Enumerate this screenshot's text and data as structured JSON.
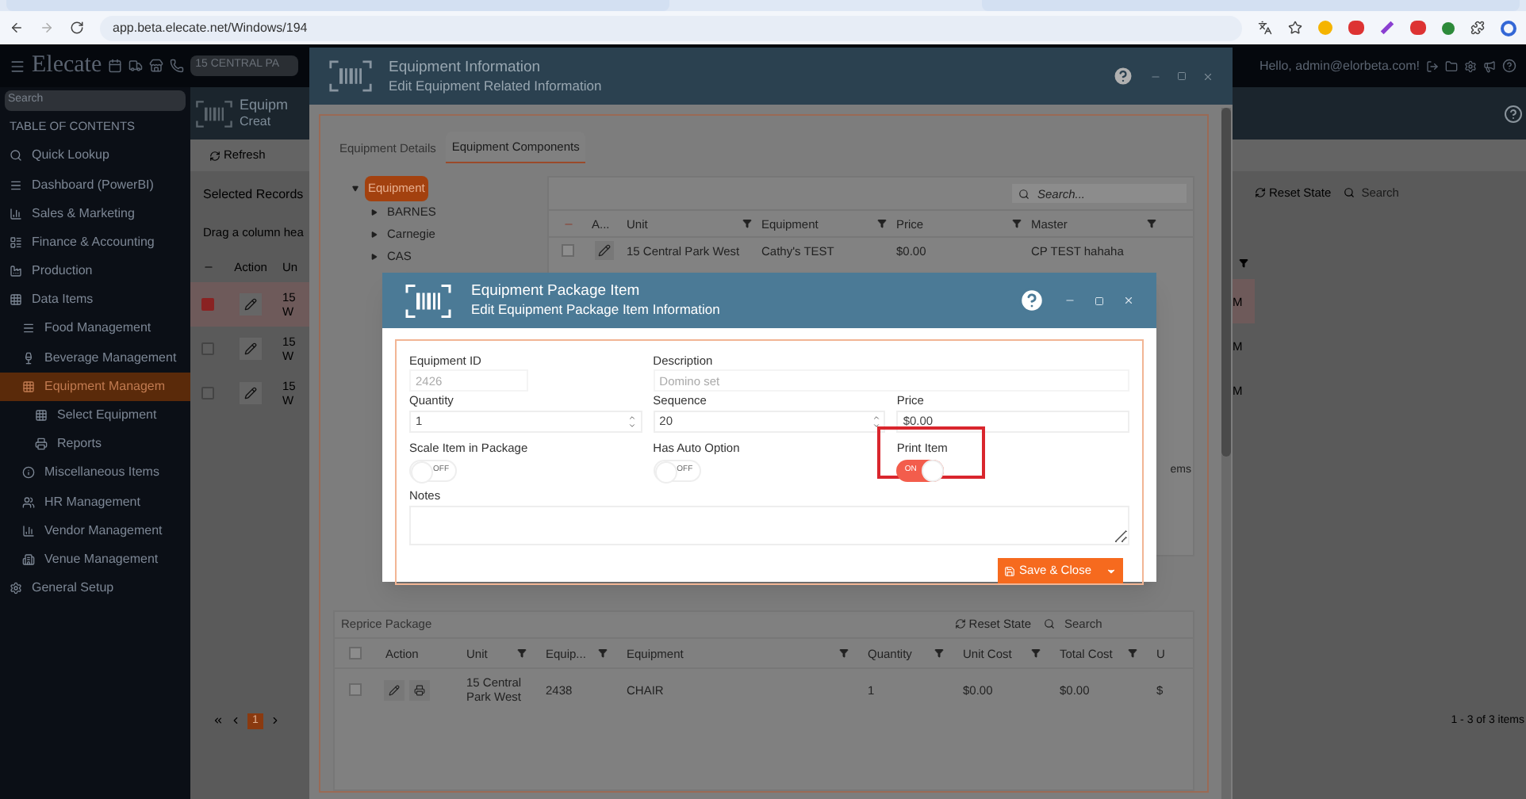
{
  "browser": {
    "url": "app.beta.elecate.net/Windows/194"
  },
  "header": {
    "brand": "Elecate",
    "location": "15 CENTRAL PA",
    "greeting": "Hello, admin@elorbeta.com!"
  },
  "sidebar": {
    "search_placeholder": "Search",
    "toc_title": "TABLE OF CONTENTS",
    "items": [
      {
        "label": "Quick Lookup",
        "selected": false
      },
      {
        "label": "Dashboard (PowerBI)",
        "selected": false
      },
      {
        "label": "Sales & Marketing",
        "selected": false
      },
      {
        "label": "Finance & Accounting",
        "selected": false
      },
      {
        "label": "Production",
        "selected": false
      },
      {
        "label": "Data Items",
        "selected": false,
        "children": [
          {
            "label": "Food Management",
            "selected": false
          },
          {
            "label": "Beverage Management",
            "selected": false
          },
          {
            "label": "Equipment Managem",
            "selected": true,
            "children": [
              {
                "label": "Select Equipment",
                "selected": false
              },
              {
                "label": "Reports",
                "selected": false
              }
            ]
          },
          {
            "label": "Miscellaneous Items",
            "selected": false
          },
          {
            "label": "HR Management",
            "selected": false
          },
          {
            "label": "Vendor Management",
            "selected": false
          },
          {
            "label": "Venue Management",
            "selected": false
          }
        ]
      },
      {
        "label": "General Setup",
        "selected": false
      }
    ]
  },
  "page": {
    "title": "Equipm",
    "subtitle": "Creat",
    "refresh": "Refresh",
    "selected_records": "Selected Records",
    "drag_hint": "Drag a column hea",
    "columns": [
      "Action",
      "Un"
    ],
    "rows": [
      {
        "selected": true,
        "cell_1": "15",
        "cell_2": "W",
        "cell_3": "M"
      },
      {
        "selected": false,
        "cell_1": "15",
        "cell_2": "W",
        "cell_3": "M"
      },
      {
        "selected": false,
        "cell_1": "15",
        "cell_2": "W",
        "cell_3": "M"
      }
    ],
    "reset_state": "Reset State",
    "search_placeholder": "Search",
    "pager": {
      "pages": [
        {
          "label": "1",
          "selected": true
        }
      ],
      "summary": "1 - 3 of 3 items"
    }
  },
  "equipment_window": {
    "title": "Equipment Information",
    "subtitle": "Edit Equipment Related Information",
    "tabs": [
      {
        "label": "Equipment Details",
        "selected": false
      },
      {
        "label": "Equipment Components",
        "selected": true
      }
    ],
    "tree": {
      "label": "Equipment",
      "expanded": true,
      "selected": true,
      "children": [
        {
          "label": "BARNES",
          "expanded": false
        },
        {
          "label": "Carnegie",
          "expanded": false
        },
        {
          "label": "CAS",
          "expanded": false
        }
      ]
    },
    "grid": {
      "search_placeholder": "Search...",
      "action_header": "A...",
      "select_all_checked": false,
      "columns": [
        "Unit",
        "Equipment",
        "Price",
        "Master"
      ],
      "rows": [
        {
          "checked": false,
          "cells": [
            "15 Central Park West",
            "Cathy's TEST",
            "$0.00",
            "CP TEST hahaha"
          ]
        }
      ],
      "pager_tail": "ems"
    },
    "package_grid": {
      "reprice": "Reprice Package",
      "reset_state": "Reset State",
      "search_placeholder": "Search",
      "action_header": "Action",
      "select_all_checked": false,
      "columns": [
        "Unit",
        "Equip...",
        "Equipment",
        "Quantity",
        "Unit Cost",
        "Total Cost",
        "U"
      ],
      "rows": [
        {
          "checked": false,
          "cells": [
            "15 Central Park West",
            "2438",
            "CHAIR",
            "1",
            "$0.00",
            "$0.00",
            "$"
          ]
        }
      ]
    }
  },
  "dialog": {
    "title": "Equipment Package Item",
    "subtitle": "Edit Equipment Package Item Information",
    "fields": [
      {
        "label": "Equipment ID",
        "value": "2426",
        "kind": "text",
        "disabled": true
      },
      {
        "label": "Description",
        "value": "Domino set",
        "kind": "text",
        "disabled": true
      },
      {
        "label": "Quantity",
        "value": "1",
        "kind": "spinner",
        "disabled": false
      },
      {
        "label": "Sequence",
        "value": "20",
        "kind": "spinner",
        "disabled": false
      },
      {
        "label": "Price",
        "value": "$0.00",
        "kind": "text",
        "disabled": false
      }
    ],
    "toggles": [
      {
        "label": "Scale Item in Package",
        "on": false,
        "state_text": "OFF",
        "highlighted": false
      },
      {
        "label": "Has Auto Option",
        "on": false,
        "state_text": "OFF",
        "highlighted": false
      },
      {
        "label": "Print Item",
        "on": true,
        "state_text": "ON",
        "highlighted": true
      }
    ],
    "notes_label": "Notes",
    "save": "Save & Close"
  }
}
